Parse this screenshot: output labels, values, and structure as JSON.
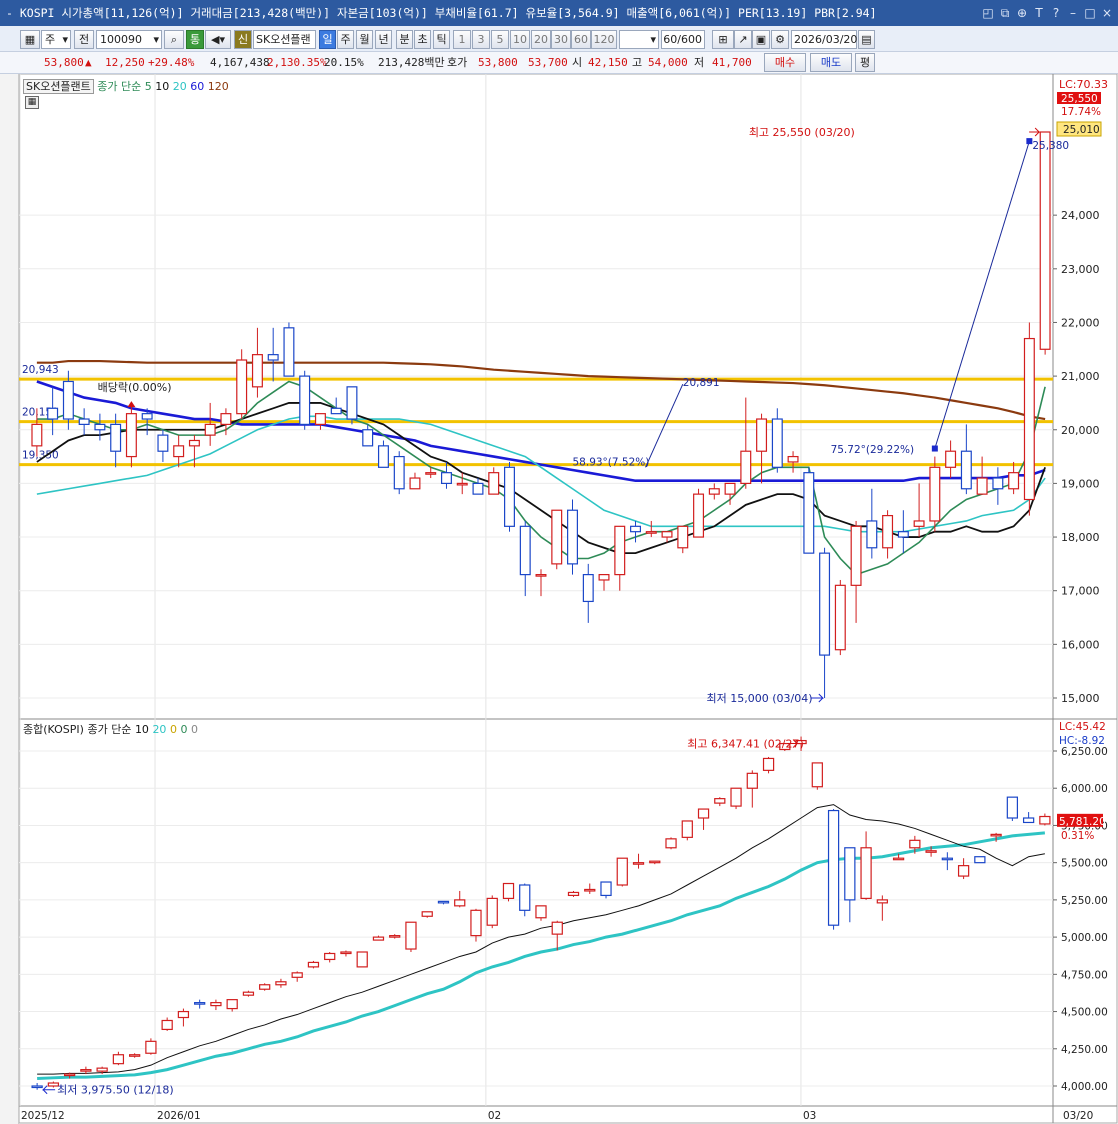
{
  "title_bar": {
    "text": "- KOSPI 시가총액[11,126(억)] 거래대금[213,428(백만)] 자본금[103(억)] 부채비율[61.7] 유보율[3,564.9] 매출액[6,061(억)] PER[13.19] PBR[2.94]",
    "icons": [
      "restore-icon",
      "copy-icon",
      "pin-icon",
      "text-icon",
      "help-icon",
      "minimize-icon",
      "maximize-icon",
      "close-icon"
    ]
  },
  "toolbar": {
    "market": "주",
    "jeon": "전",
    "code": "100090",
    "stock_name": "SK오션플랜",
    "tong": "통",
    "sin": "신",
    "il": "일",
    "periods": [
      "주",
      "월",
      "년",
      "분",
      "초",
      "틱"
    ],
    "nums": [
      "1",
      "3",
      "5",
      "10",
      "20",
      "30",
      "60",
      "120"
    ],
    "count": "60",
    "total": "/600",
    "date": "2026/03/20"
  },
  "infobar": {
    "price": "53,800",
    "arrow": "▲",
    "change": "12,250",
    "change_pct": "+29.48%",
    "volume": "4,167,438",
    "vol_ratio": "2,130.35%",
    "turnover": "20.15%",
    "amount": "213,428백만",
    "hoga_label": "호가",
    "hoga1": "53,800",
    "hoga2": "53,700",
    "open_label": "시",
    "open": "42,150",
    "high_label": "고",
    "high": "54,000",
    "low_label": "저",
    "low": "41,700",
    "buy_btn": "매수",
    "sell_btn": "매도",
    "avg_btn": "평"
  },
  "main_chart": {
    "legend": {
      "name": "SK오션플랜트",
      "type": "종가 단순",
      "ma": [
        "5",
        "10",
        "20",
        "60",
        "120"
      ]
    },
    "ma_colors": [
      "#2e8b57",
      "#111111",
      "#2ec4c4",
      "#1a1ad6",
      "#8b3a0f"
    ],
    "y_ticks": [
      "24,000",
      "23,000",
      "22,000",
      "21,000",
      "20,000",
      "19,000",
      "18,000",
      "17,000",
      "16,000",
      "15,000"
    ],
    "y_values": [
      24000,
      23000,
      22000,
      21000,
      20000,
      19000,
      18000,
      17000,
      16000,
      15000
    ],
    "lc": "LC:70.33",
    "last_price": "25,550",
    "last_pct": "17.74%",
    "level_price": "25,010",
    "h_levels": [
      {
        "label": "20,943",
        "value": 20943
      },
      {
        "label": "20,151",
        "value": 20151
      },
      {
        "label": "19,350",
        "value": 19350
      }
    ],
    "annotations": {
      "high": "최고 25,550 (03/20)",
      "low": "최저 15,000 (03/04)",
      "baedang": "배당락(0.00%)",
      "line_top": "20,891",
      "line1": "58.93°(7.52%)",
      "line2": "75.72°(29.22%)",
      "line2_end": "25,380"
    },
    "candles": [
      [
        19700,
        20400,
        19500,
        20100
      ],
      [
        20400,
        20800,
        19900,
        20200
      ],
      [
        20900,
        21100,
        20000,
        20200
      ],
      [
        20200,
        20400,
        19900,
        20100
      ],
      [
        20100,
        20300,
        19800,
        20000
      ],
      [
        20100,
        20300,
        19300,
        19600
      ],
      [
        19500,
        20500,
        19300,
        20300
      ],
      [
        20300,
        20400,
        19900,
        20200
      ],
      [
        19900,
        20000,
        19400,
        19600
      ],
      [
        19500,
        19900,
        19300,
        19700
      ],
      [
        19700,
        19900,
        19300,
        19800
      ],
      [
        19900,
        20500,
        19700,
        20100
      ],
      [
        20100,
        20400,
        19900,
        20300
      ],
      [
        20300,
        21500,
        20200,
        21300
      ],
      [
        20800,
        21900,
        20600,
        21400
      ],
      [
        21400,
        21900,
        20900,
        21300
      ],
      [
        21900,
        22000,
        21000,
        21000
      ],
      [
        21000,
        21100,
        20000,
        20100
      ],
      [
        20100,
        20300,
        20000,
        20300
      ],
      [
        20400,
        20600,
        20300,
        20300
      ],
      [
        20800,
        20800,
        20100,
        20200
      ],
      [
        20000,
        20100,
        19700,
        19700
      ],
      [
        19700,
        19800,
        19400,
        19300
      ],
      [
        19500,
        19600,
        18800,
        18900
      ],
      [
        18900,
        19200,
        18900,
        19100
      ],
      [
        19200,
        19300,
        19100,
        19200
      ],
      [
        19200,
        19400,
        18900,
        19000
      ],
      [
        19000,
        19200,
        18800,
        19000
      ],
      [
        19000,
        19100,
        18800,
        18800
      ],
      [
        18800,
        19300,
        18800,
        19200
      ],
      [
        19300,
        19400,
        18100,
        18200
      ],
      [
        18200,
        18300,
        16900,
        17300
      ],
      [
        17300,
        17400,
        16900,
        17300
      ],
      [
        17500,
        18500,
        17400,
        18500
      ],
      [
        18500,
        18700,
        17300,
        17500
      ],
      [
        17300,
        17500,
        16400,
        16800
      ],
      [
        17200,
        17300,
        17000,
        17300
      ],
      [
        17300,
        18200,
        17000,
        18200
      ],
      [
        18200,
        18300,
        17900,
        18100
      ],
      [
        18100,
        18300,
        18000,
        18100
      ],
      [
        18000,
        18100,
        17900,
        18100
      ],
      [
        17800,
        18200,
        17700,
        18200
      ],
      [
        18000,
        18900,
        18000,
        18800
      ],
      [
        18800,
        19000,
        18700,
        18900
      ],
      [
        18800,
        19000,
        18600,
        19000
      ],
      [
        19000,
        20600,
        18900,
        19600
      ],
      [
        19600,
        20300,
        19000,
        20200
      ],
      [
        20200,
        20400,
        19200,
        19300
      ],
      [
        19400,
        19600,
        19200,
        19500
      ],
      [
        19200,
        19300,
        18000,
        17700
      ],
      [
        17700,
        17800,
        15000,
        15800
      ],
      [
        15900,
        17200,
        15800,
        17100
      ],
      [
        17100,
        18300,
        16400,
        18200
      ],
      [
        18300,
        18900,
        17600,
        17800
      ],
      [
        17800,
        18500,
        17600,
        18400
      ],
      [
        18100,
        18500,
        17700,
        18000
      ],
      [
        18200,
        19000,
        18000,
        18300
      ],
      [
        18300,
        19500,
        18100,
        19300
      ],
      [
        19300,
        19800,
        19100,
        19600
      ],
      [
        19600,
        20100,
        18800,
        18900
      ],
      [
        18800,
        19500,
        18800,
        19100
      ],
      [
        19100,
        19300,
        18600,
        18900
      ],
      [
        18900,
        19400,
        18800,
        19200
      ],
      [
        18700,
        22000,
        18400,
        21700
      ],
      [
        21500,
        25550,
        21400,
        25550
      ]
    ],
    "ma_series": {
      "ma5": [
        20200,
        20200,
        20300,
        20200,
        20100,
        20000,
        20000,
        20100,
        20000,
        19900,
        19900,
        19900,
        20000,
        20200,
        20500,
        20700,
        20900,
        20800,
        20600,
        20400,
        20200,
        20100,
        19900,
        19700,
        19500,
        19300,
        19200,
        19100,
        19000,
        18900,
        18700,
        18300,
        18000,
        17800,
        17600,
        17600,
        17700,
        17900,
        18000,
        18100,
        18100,
        18200,
        18300,
        18500,
        18700,
        19000,
        19200,
        19300,
        19300,
        19300,
        18000,
        17600,
        17300,
        17400,
        17500,
        17700,
        17900,
        18200,
        18500,
        18700,
        18800,
        18900,
        19000,
        19600,
        20800
      ],
      "ma10": [
        19400,
        19600,
        19800,
        19900,
        19900,
        19950,
        20000,
        20000,
        20000,
        20000,
        20000,
        20000,
        20100,
        20200,
        20300,
        20400,
        20500,
        20500,
        20500,
        20400,
        20300,
        20200,
        20100,
        19900,
        19700,
        19500,
        19400,
        19200,
        19100,
        19000,
        18900,
        18700,
        18500,
        18300,
        18100,
        17900,
        17800,
        17700,
        17700,
        17800,
        17900,
        18000,
        18100,
        18200,
        18400,
        18600,
        18700,
        18800,
        18800,
        18700,
        18400,
        18300,
        18200,
        18200,
        18100,
        18000,
        18000,
        18100,
        18100,
        18200,
        18100,
        18100,
        18200,
        18500,
        19300
      ],
      "ma20": [
        18800,
        18850,
        18900,
        18950,
        19000,
        19050,
        19100,
        19150,
        19250,
        19350,
        19450,
        19550,
        19700,
        19850,
        20000,
        20100,
        20200,
        20250,
        20250,
        20200,
        20200,
        20200,
        20200,
        20200,
        20150,
        20100,
        20000,
        19900,
        19800,
        19700,
        19600,
        19500,
        19300,
        19100,
        18900,
        18700,
        18500,
        18400,
        18300,
        18200,
        18200,
        18200,
        18200,
        18200,
        18200,
        18200,
        18200,
        18200,
        18200,
        18200,
        18200,
        18150,
        18100,
        18100,
        18100,
        18100,
        18150,
        18200,
        18250,
        18300,
        18400,
        18450,
        18500,
        18700,
        19100
      ],
      "ma60": [
        20900,
        20800,
        20700,
        20600,
        20550,
        20500,
        20400,
        20350,
        20300,
        20250,
        20200,
        20200,
        20150,
        20100,
        20100,
        20100,
        20100,
        20100,
        20100,
        20050,
        20000,
        19950,
        19900,
        19850,
        19800,
        19700,
        19650,
        19600,
        19550,
        19500,
        19450,
        19400,
        19350,
        19300,
        19250,
        19200,
        19150,
        19100,
        19050,
        19050,
        19050,
        19050,
        19050,
        19050,
        19050,
        19050,
        19050,
        19050,
        19050,
        19050,
        19050,
        19050,
        19050,
        19050,
        19050,
        19050,
        19100,
        19100,
        19100,
        19100,
        19100,
        19100,
        19150,
        19150,
        19250
      ],
      "ma120": [
        21250,
        21250,
        21280,
        21280,
        21280,
        21270,
        21260,
        21250,
        21250,
        21250,
        21250,
        21250,
        21250,
        21250,
        21250,
        21250,
        21250,
        21250,
        21250,
        21250,
        21250,
        21250,
        21250,
        21240,
        21230,
        21220,
        21200,
        21180,
        21150,
        21120,
        21100,
        21080,
        21060,
        21040,
        21020,
        21000,
        20990,
        20980,
        20970,
        20960,
        20950,
        20940,
        20930,
        20920,
        20910,
        20900,
        20890,
        20880,
        20870,
        20850,
        20830,
        20800,
        20770,
        20740,
        20710,
        20680,
        20640,
        20600,
        20550,
        20500,
        20450,
        20400,
        20330,
        20250,
        20200
      ]
    }
  },
  "sub_chart": {
    "legend": {
      "name": "종합(KOSPI)",
      "type": "종가 단순",
      "ma": [
        "10",
        "20",
        "0",
        "0",
        "0"
      ]
    },
    "y_ticks": [
      "6,250.00",
      "6,000.00",
      "5,750.00",
      "5,500.00",
      "5,250.00",
      "5,000.00",
      "4,750.00",
      "4,500.00",
      "4,250.00",
      "4,000.00"
    ],
    "y_values": [
      6250,
      6000,
      5750,
      5500,
      5250,
      5000,
      4750,
      4500,
      4250,
      4000
    ],
    "lc": "LC:45.42",
    "hc": "HC:-8.92",
    "last_price": "5,781.20",
    "last_pct": "0.31%",
    "annotations": {
      "high": "최고 6,347.41 (02/27)",
      "low": "최저 3,975.50 (12/18)"
    },
    "candles": [
      [
        4000,
        4020,
        3975,
        3995
      ],
      [
        4000,
        4030,
        3990,
        4020
      ],
      [
        4070,
        4090,
        4050,
        4080
      ],
      [
        4100,
        4130,
        4080,
        4110
      ],
      [
        4100,
        4130,
        4080,
        4120
      ],
      [
        4150,
        4230,
        4140,
        4210
      ],
      [
        4200,
        4220,
        4190,
        4210
      ],
      [
        4220,
        4320,
        4210,
        4300
      ],
      [
        4380,
        4460,
        4370,
        4440
      ],
      [
        4460,
        4520,
        4400,
        4500
      ],
      [
        4560,
        4580,
        4520,
        4550
      ],
      [
        4540,
        4580,
        4510,
        4560
      ],
      [
        4520,
        4580,
        4500,
        4580
      ],
      [
        4610,
        4640,
        4600,
        4630
      ],
      [
        4650,
        4690,
        4640,
        4680
      ],
      [
        4680,
        4720,
        4660,
        4700
      ],
      [
        4730,
        4770,
        4700,
        4760
      ],
      [
        4800,
        4840,
        4790,
        4830
      ],
      [
        4850,
        4900,
        4830,
        4890
      ],
      [
        4890,
        4910,
        4870,
        4900
      ],
      [
        4800,
        4900,
        4800,
        4900
      ],
      [
        4980,
        5010,
        4980,
        5000
      ],
      [
        5000,
        5020,
        4990,
        5010
      ],
      [
        4920,
        5100,
        4900,
        5100
      ],
      [
        5140,
        5170,
        5130,
        5170
      ],
      [
        5240,
        5240,
        5220,
        5230
      ],
      [
        5210,
        5310,
        5200,
        5250
      ],
      [
        5010,
        5190,
        4970,
        5180
      ],
      [
        5080,
        5280,
        5060,
        5260
      ],
      [
        5260,
        5360,
        5240,
        5360
      ],
      [
        5350,
        5360,
        5140,
        5180
      ],
      [
        5130,
        5210,
        5110,
        5210
      ],
      [
        5020,
        5110,
        4910,
        5100
      ],
      [
        5280,
        5310,
        5270,
        5300
      ],
      [
        5320,
        5360,
        5290,
        5320
      ],
      [
        5370,
        5360,
        5260,
        5280
      ],
      [
        5350,
        5530,
        5340,
        5530
      ],
      [
        5490,
        5560,
        5460,
        5500
      ],
      [
        5510,
        5510,
        5490,
        5510
      ],
      [
        5600,
        5670,
        5590,
        5660
      ],
      [
        5670,
        5770,
        5650,
        5780
      ],
      [
        5800,
        5860,
        5720,
        5860
      ],
      [
        5900,
        5940,
        5880,
        5930
      ],
      [
        5880,
        6000,
        5860,
        6000
      ],
      [
        6000,
        6120,
        5870,
        6100
      ],
      [
        6120,
        6210,
        6100,
        6200
      ],
      [
        6260,
        6300,
        6250,
        6300
      ],
      [
        6300,
        6347,
        6250,
        6320
      ],
      [
        6010,
        6170,
        5990,
        6170
      ],
      [
        5850,
        5860,
        5050,
        5080
      ],
      [
        5600,
        5580,
        5100,
        5250
      ],
      [
        5260,
        5710,
        5250,
        5600
      ],
      [
        5230,
        5280,
        5110,
        5250
      ],
      [
        5530,
        5560,
        5530,
        5530
      ],
      [
        5600,
        5680,
        5560,
        5650
      ],
      [
        5570,
        5610,
        5540,
        5580
      ],
      [
        5530,
        5570,
        5450,
        5520
      ],
      [
        5410,
        5530,
        5390,
        5480
      ],
      [
        5540,
        5540,
        5500,
        5500
      ],
      [
        5690,
        5700,
        5640,
        5690
      ],
      [
        5940,
        5940,
        5780,
        5800
      ],
      [
        5800,
        5840,
        5780,
        5770
      ],
      [
        5760,
        5830,
        5750,
        5810
      ]
    ],
    "ma10": [
      4080,
      4080,
      4085,
      4085,
      4090,
      4095,
      4110,
      4140,
      4190,
      4230,
      4270,
      4300,
      4340,
      4380,
      4410,
      4450,
      4480,
      4520,
      4560,
      4600,
      4630,
      4670,
      4710,
      4750,
      4790,
      4830,
      4870,
      4900,
      4960,
      5000,
      5020,
      5060,
      5080,
      5110,
      5130,
      5150,
      5180,
      5210,
      5250,
      5290,
      5350,
      5410,
      5470,
      5530,
      5600,
      5660,
      5730,
      5800,
      5870,
      5890,
      5820,
      5790,
      5780,
      5760,
      5730,
      5690,
      5650,
      5610,
      5590,
      5530,
      5480,
      5540,
      5560
    ],
    "ma20": [
      4050,
      4055,
      4060,
      4060,
      4065,
      4070,
      4075,
      4090,
      4110,
      4140,
      4170,
      4200,
      4220,
      4250,
      4280,
      4300,
      4330,
      4370,
      4400,
      4430,
      4470,
      4500,
      4540,
      4580,
      4620,
      4650,
      4700,
      4760,
      4800,
      4830,
      4870,
      4900,
      4920,
      4950,
      4970,
      5000,
      5020,
      5050,
      5080,
      5110,
      5150,
      5180,
      5210,
      5260,
      5300,
      5340,
      5390,
      5450,
      5500,
      5520,
      5530,
      5530,
      5540,
      5560,
      5580,
      5600,
      5610,
      5620,
      5640,
      5660,
      5680,
      5690,
      5700
    ]
  },
  "x_axis": {
    "labels": [
      "2025/12",
      "2026/01",
      "02",
      "03",
      "03/20"
    ]
  }
}
